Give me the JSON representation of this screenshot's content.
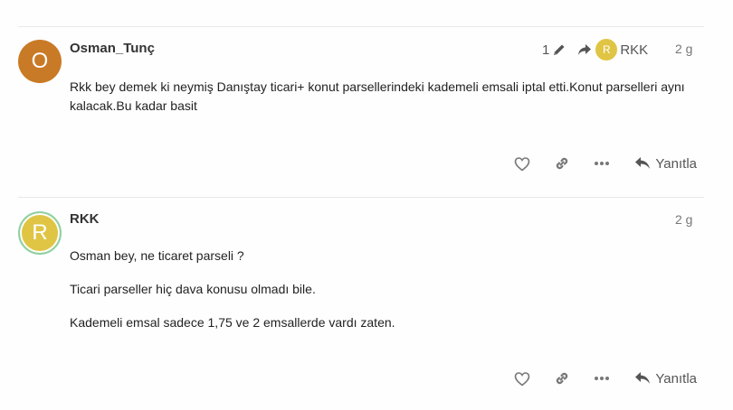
{
  "posts": [
    {
      "avatar_letter": "O",
      "avatar_color": "#c97a26",
      "username": "Osman_Tunç",
      "edit_count": "1",
      "reply_to": {
        "avatar_letter": "R",
        "avatar_color": "#e0c545",
        "username": "RKK"
      },
      "date": "2 g",
      "paragraphs": [
        "Rkk bey demek ki neymiş Danıştay ticari+ konut parsellerindeki kademeli emsali iptal etti.Konut parselleri aynı kalacak.Bu kadar basit"
      ],
      "reply_label": "Yanıtla"
    },
    {
      "avatar_letter": "R",
      "avatar_color": "#e0c545",
      "avatar_ring": "#8fd1a4",
      "username": "RKK",
      "date": "2 g",
      "paragraphs": [
        "Osman bey, ne ticaret parseli ?",
        "Ticari parseller hiç dava konusu olmadı bile.",
        "Kademeli emsal sadece 1,75 ve 2 emsallerde vardı zaten."
      ],
      "reply_label": "Yanıtla"
    }
  ]
}
